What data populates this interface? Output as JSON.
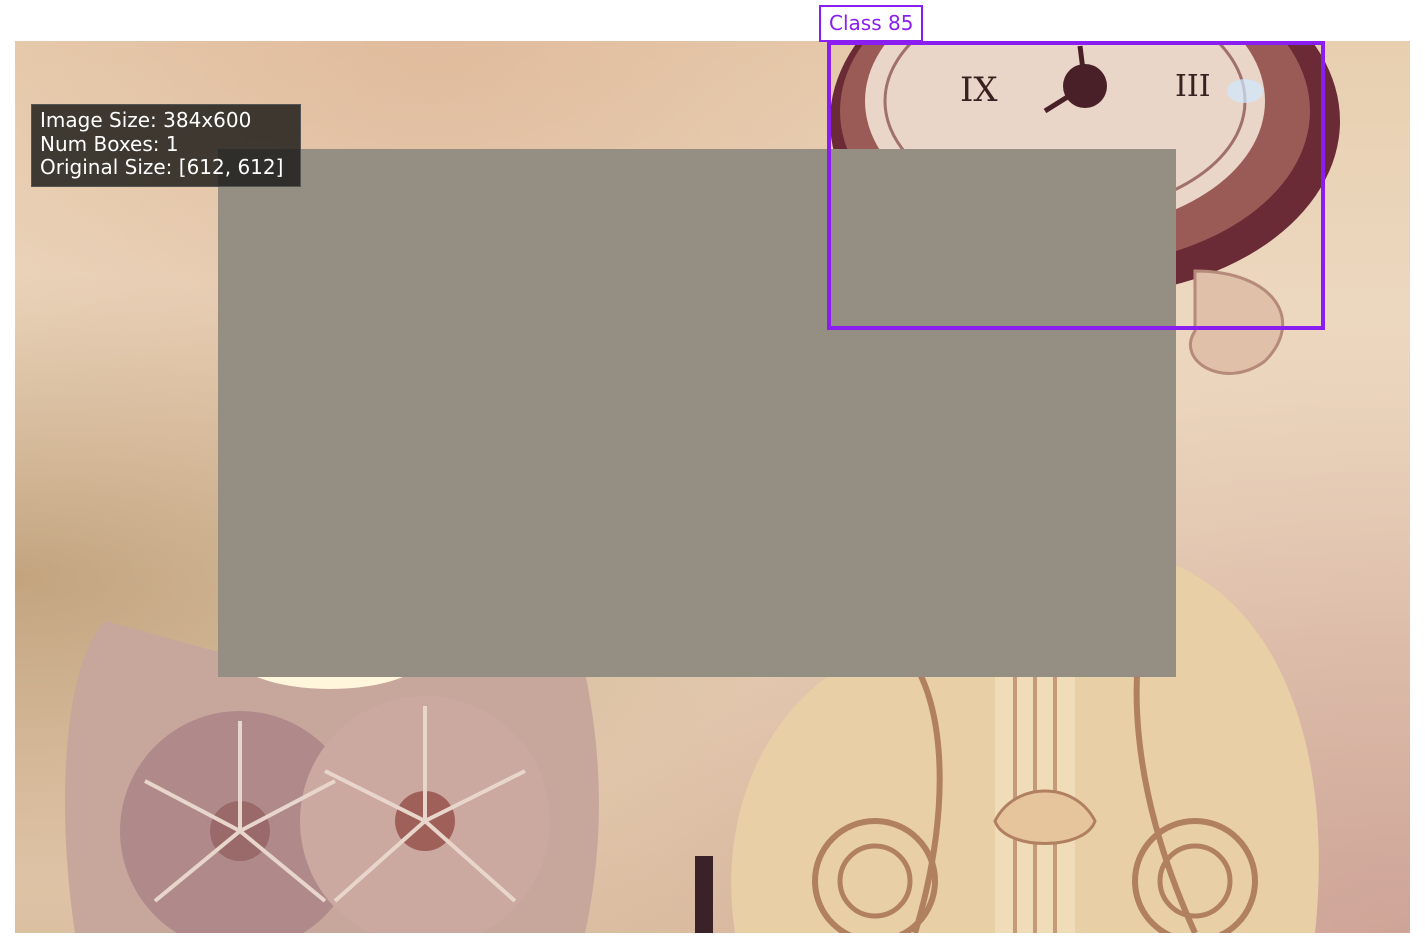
{
  "info": {
    "image_size": "Image Size: 384x600",
    "num_boxes": "Num Boxes: 1",
    "original_size": "Original Size: [612, 612]"
  },
  "annotations": [
    {
      "label": "Class 85",
      "color": "#8a1ef0"
    }
  ],
  "colors": {
    "mask": "#958e83",
    "info_background": "#1e1e1b"
  }
}
